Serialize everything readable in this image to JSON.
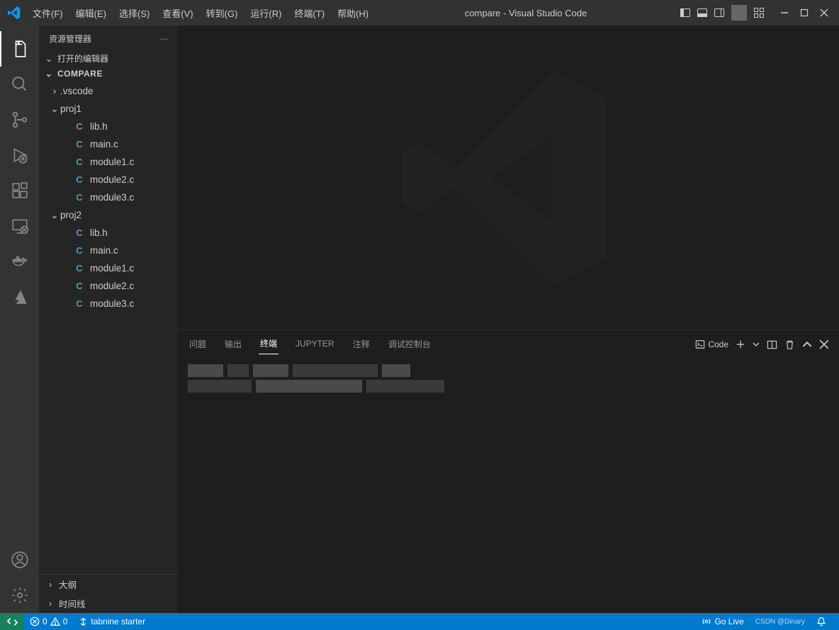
{
  "title": "compare - Visual Studio Code",
  "menu": [
    "文件(F)",
    "编辑(E)",
    "选择(S)",
    "查看(V)",
    "转到(G)",
    "运行(R)",
    "终端(T)",
    "帮助(H)"
  ],
  "activity": [
    {
      "name": "explorer",
      "active": true
    },
    {
      "name": "search"
    },
    {
      "name": "scm"
    },
    {
      "name": "run-debug"
    },
    {
      "name": "extensions"
    },
    {
      "name": "remote-explorer"
    },
    {
      "name": "docker"
    },
    {
      "name": "azure"
    }
  ],
  "activityBottom": [
    {
      "name": "accounts"
    },
    {
      "name": "settings"
    }
  ],
  "sidebar": {
    "title": "资源管理器",
    "sections": {
      "openEditors": "打开的编辑器",
      "workspace": "COMPARE",
      "outline": "大纲",
      "timeline": "时间线"
    },
    "tree": [
      {
        "type": "folder",
        "name": ".vscode",
        "depth": 1,
        "expanded": false
      },
      {
        "type": "folder",
        "name": "proj1",
        "depth": 1,
        "expanded": true
      },
      {
        "type": "file",
        "name": "lib.h",
        "depth": 2,
        "lang": "h"
      },
      {
        "type": "file",
        "name": "main.c",
        "depth": 2,
        "lang": "c"
      },
      {
        "type": "file",
        "name": "module1.c",
        "depth": 2,
        "lang": "c"
      },
      {
        "type": "file",
        "name": "module2.c",
        "depth": 2,
        "lang": "c"
      },
      {
        "type": "file",
        "name": "module3.c",
        "depth": 2,
        "lang": "c"
      },
      {
        "type": "folder",
        "name": "proj2",
        "depth": 1,
        "expanded": true
      },
      {
        "type": "file",
        "name": "lib.h",
        "depth": 2,
        "lang": "h"
      },
      {
        "type": "file",
        "name": "main.c",
        "depth": 2,
        "lang": "c"
      },
      {
        "type": "file",
        "name": "module1.c",
        "depth": 2,
        "lang": "c"
      },
      {
        "type": "file",
        "name": "module2.c",
        "depth": 2,
        "lang": "c"
      },
      {
        "type": "file",
        "name": "module3.c",
        "depth": 2,
        "lang": "c"
      }
    ]
  },
  "panel": {
    "tabs": [
      "问题",
      "输出",
      "终端",
      "JUPYTER",
      "注释",
      "调试控制台"
    ],
    "activeTab": 2,
    "profileLabel": "Code"
  },
  "statusbar": {
    "errors": "0",
    "warnings": "0",
    "tabnine": "tabnine starter",
    "golive": "Go Live",
    "watermark": "CSDN @Dinary"
  }
}
